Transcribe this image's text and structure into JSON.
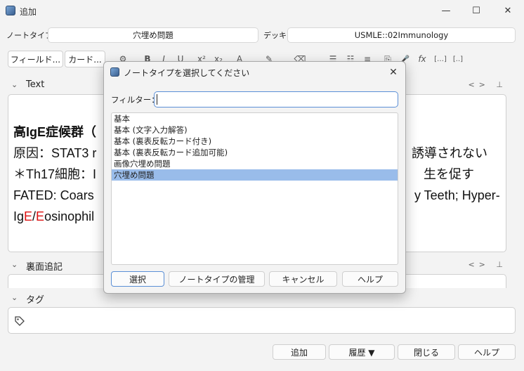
{
  "window": {
    "title": "追加",
    "minimize": "—",
    "maximize": "☐",
    "close": "✕"
  },
  "note_type_row": {
    "note_type_label": "ノートタイプ",
    "note_type_value": "穴埋め問題",
    "deck_label": "デッキ",
    "deck_value": "USMLE::02Immunology"
  },
  "toolbar": {
    "fields_button": "フィールド...",
    "cards_button": "カード...",
    "icons": [
      "gear-icon",
      "bold-icon",
      "italic-icon",
      "underline-icon",
      "superscript-icon",
      "subscript-icon",
      "font-color-icon",
      "highlight-icon",
      "eraser-icon",
      "bullet-list-icon",
      "numbered-list-icon",
      "align-icon",
      "attach-icon",
      "record-icon",
      "math-icon",
      "cloze-icon",
      "cloze-same-icon"
    ],
    "icon_glyphs": [
      "⚙",
      "B",
      "I",
      "U",
      "x²",
      "x₂",
      "A",
      "✎",
      "⌫",
      "☰",
      "☷",
      "≡",
      "⎘",
      "🎤",
      "fx",
      "[…]",
      "[..]"
    ]
  },
  "sections": {
    "text_label": "Text",
    "back_extra_label": "裏面追記",
    "tags_label": "タグ",
    "html_toggle": "<>",
    "pin": "⊥"
  },
  "editor": {
    "line1_bold": "高IgE症候群（",
    "line2_start": "原因：STAT3 r",
    "line2_end": "誘導されない",
    "line3_start": "＊Th17細胞：I",
    "line3_end": "生を促す",
    "line4_start": " FATED: Coars",
    "line4_end": "y Teeth; Hyper-",
    "line5_prefix": "Ig",
    "line5_e1": "E",
    "line5_slash": "/",
    "line5_e2": "E",
    "line5_rest": "osinophil"
  },
  "bottom_buttons": {
    "add": "追加",
    "history": "履歴 ▼",
    "close": "閉じる",
    "help": "ヘルプ"
  },
  "dialog": {
    "title": "ノートタイプを選択してください",
    "filter_label": "フィルター：",
    "filter_value": "",
    "items": [
      "基本",
      "基本 (文字入力解答)",
      "基本 (裏表反転カード付き)",
      "基本 (裏表反転カード追加可能)",
      "画像穴埋め問題",
      "穴埋め問題"
    ],
    "selected_item": "穴埋め問題",
    "buttons": {
      "choose": "選択",
      "manage": "ノートタイプの管理",
      "cancel": "キャンセル",
      "help": "ヘルプ"
    }
  },
  "colors": {
    "accent": "#5b8fd6",
    "selection": "#99bcea",
    "cloze_red": "#d11111"
  }
}
